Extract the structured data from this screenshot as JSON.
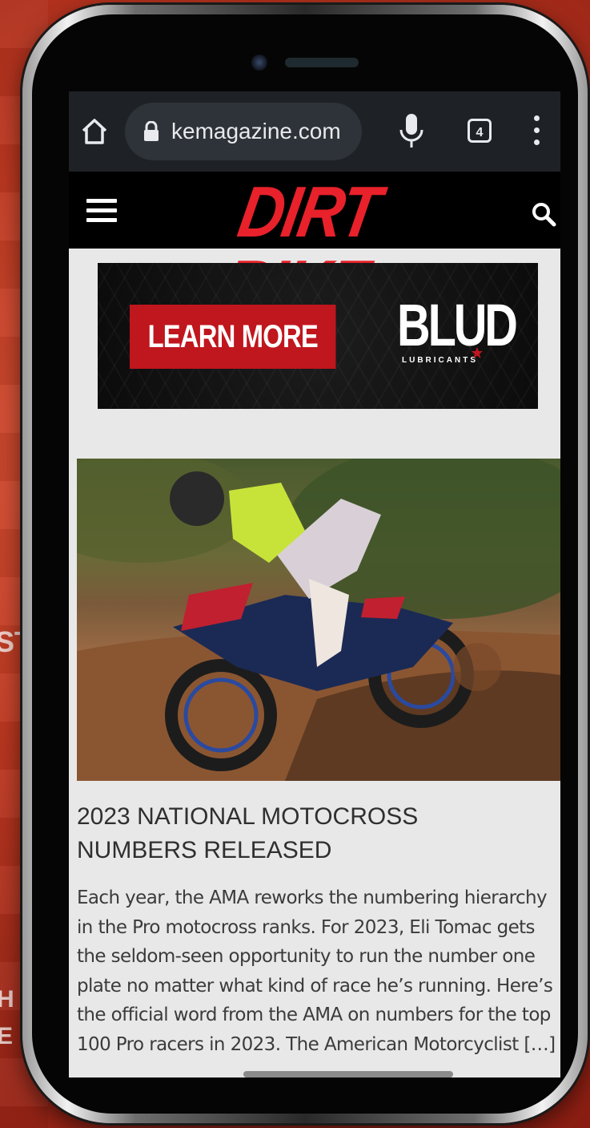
{
  "browser": {
    "url": "kemagazine.com",
    "tab_count": "4"
  },
  "site": {
    "logo": "DIRT BIKE"
  },
  "ad": {
    "button_label": "LEARN MORE",
    "brand": "BLUD",
    "brand_sub": "LUBRICANTS"
  },
  "article": {
    "title": "2023 NATIONAL MOTOCROSS NUMBERS RELEASED",
    "excerpt": "Each year, the AMA reworks the numbering hierarchy in the Pro motocross ranks. For 2023, Eli Tomac gets the seldom-seen opportunity to run the number one plate no matter what kind of race he’s running. Here’s the official word from the AMA on numbers for the top 100 Pro racers in 2023. The American Motorcyclist […]"
  },
  "background": {
    "left_letters": [
      "ST",
      "H",
      "E"
    ]
  },
  "colors": {
    "brand_red": "#e8212b",
    "ad_button": "#c0161e",
    "browser_bar": "#1e2226"
  }
}
